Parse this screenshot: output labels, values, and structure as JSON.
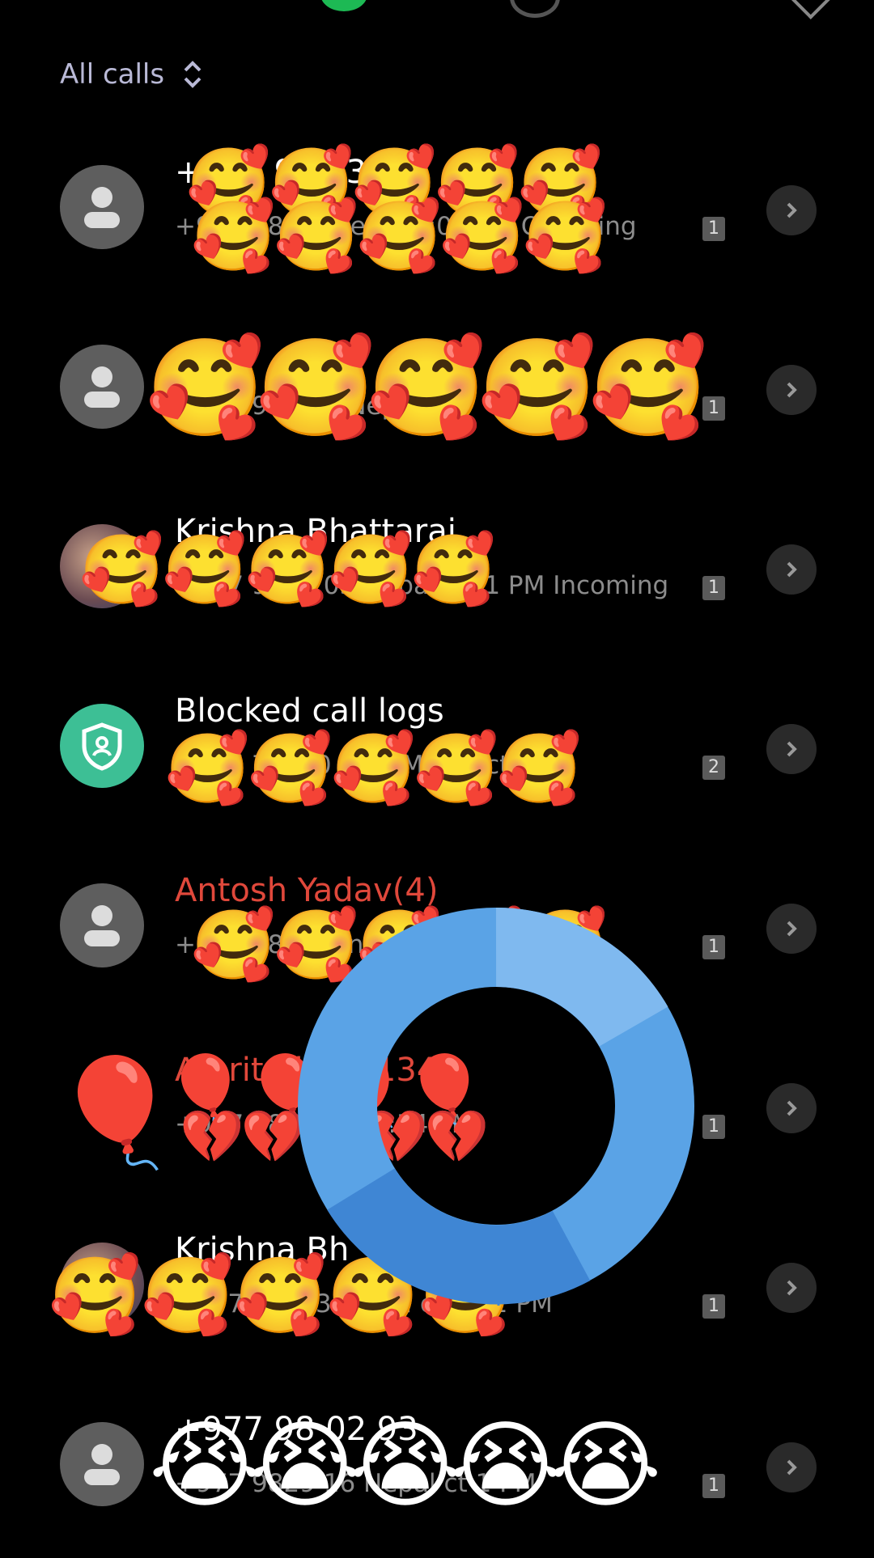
{
  "filter": {
    "label": "All calls"
  },
  "colors": {
    "missed": "#e0483b",
    "shield": "#3dbf95",
    "ring": "#5aa3e6"
  },
  "calls": [
    {
      "name": "+977 98 23",
      "sub": "+977 98 38 Nepal  4:04 PM Outgoing",
      "count": "1",
      "missed": false,
      "avatar": "person"
    },
    {
      "name": "a",
      "sub": "+977 98 400 Nepal PM",
      "count": "1",
      "missed": true,
      "avatar": "person"
    },
    {
      "name": "Krishna Bhattarai",
      "sub": "+977 9829 03 Nepal    4:01 PM Incoming",
      "count": "1",
      "missed": false,
      "avatar": "photo"
    },
    {
      "name": "Blocked call logs",
      "sub": "+977 79 7 0 a  0 PM Rejected",
      "count": "2",
      "missed": false,
      "avatar": "shield"
    },
    {
      "name": "Antosh Yadav(4)",
      "sub": "+977 98 9  Ran",
      "count": "1",
      "missed": true,
      "avatar": "person"
    },
    {
      "name": "Amrit Shiya(134)",
      "sub": "+977 98  Nepal  3:54 PM",
      "count": "1",
      "missed": true,
      "avatar": "balloon"
    },
    {
      "name": "Krishna Bh",
      "sub": "+977 9   1 03 Nepal ct     3:52 PM",
      "count": "1",
      "missed": false,
      "avatar": "photo"
    },
    {
      "name": "+977 98 02 93",
      "sub": "+977 9829 16 Nepal ct  1 PM",
      "count": "1",
      "missed": false,
      "avatar": "person"
    }
  ],
  "overlays": {
    "row0a": "🥰🥰🥰🥰🥰",
    "row0b": "🥰🥰🥰🥰🥰",
    "row1": "🥰🥰🥰🥰🥰",
    "row2": "🥰🥰🥰🥰🥰",
    "row3": "🥰🥰🥰🥰🥰",
    "row4": "🥰🥰🥰🥰🥰",
    "row5a": "🎈🎈🎈🎈",
    "row5b": "💔💔💔💔💔",
    "row6": "🥰🥰🥰🥰🥰",
    "row7": "😭😭😭😭😭",
    "balloon": "🎈"
  }
}
